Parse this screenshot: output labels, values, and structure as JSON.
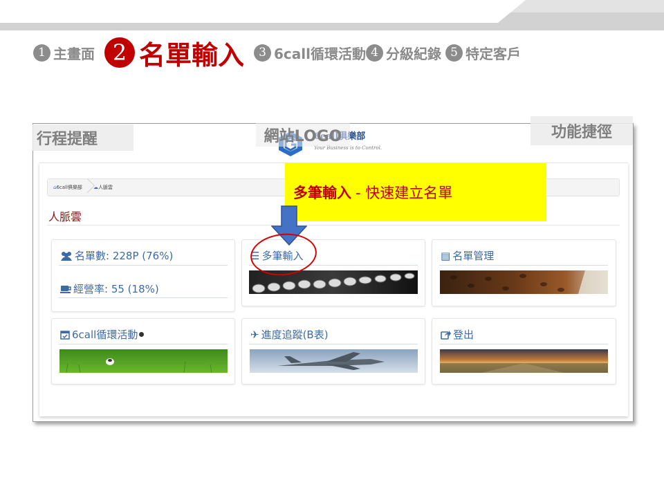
{
  "steps": [
    {
      "num": "1",
      "label": "主畫面"
    },
    {
      "num": "2",
      "label": "名單輸入"
    },
    {
      "num": "3",
      "label": "6call循環活動"
    },
    {
      "num": "4",
      "label": "分級紀錄"
    },
    {
      "num": "5",
      "label": "特定客戶"
    }
  ],
  "callouts": {
    "schedule": "行程提醒",
    "logo": "網站LOGO",
    "shortcut": "功能捷徑",
    "highlight_bold": "多筆輸入",
    "highlight_rest": " - 快速建立名單"
  },
  "logo": {
    "name": "6call俱樂部",
    "tagline": "Your Business is to Control."
  },
  "breadcrumb": {
    "home": "6call俱樂部",
    "current": "人脈雲"
  },
  "section_title": "人脈雲",
  "cards": {
    "stats": {
      "list_count": "名單數: 228P (76%)",
      "operating_rate": "經營率: 55 (18%)"
    },
    "bulk_input": "多筆輸入",
    "list_manage": "名單管理",
    "cycle_activity": "6call循環活動",
    "progress": "進度追蹤(B表)",
    "logout": "登出"
  },
  "colors": {
    "active_step": "#c00000",
    "inactive_step": "#8a8a8a",
    "card_title": "#3b6aa8",
    "highlight_bg": "#ffff00",
    "arrow": "#4472c4"
  },
  "icons": [
    "users-icon",
    "coffee-icon",
    "list-icon",
    "address-card-icon",
    "calendar-check-icon",
    "plane-icon",
    "share-icon",
    "home-icon",
    "cloud-icon"
  ]
}
